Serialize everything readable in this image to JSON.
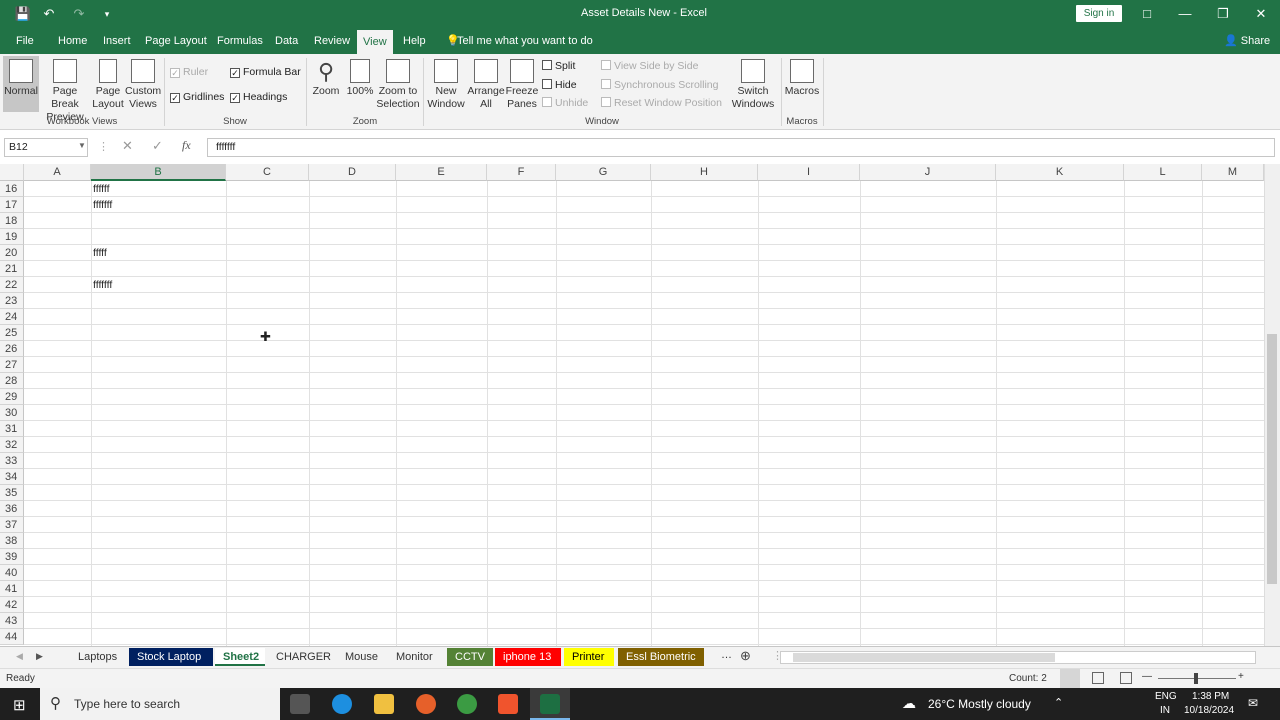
{
  "window": {
    "title": "Asset Details New  -  Excel",
    "signin": "Sign in",
    "share": "Share"
  },
  "menu": [
    "File",
    "Home",
    "Insert",
    "Page Layout",
    "Formulas",
    "Data",
    "Review",
    "View",
    "Help"
  ],
  "tell_me": "Tell me what you want to do",
  "ribbon": {
    "workbook_views": {
      "label": "Workbook Views",
      "normal": "Normal",
      "page_break_1": "Page Break",
      "page_break_2": "Preview",
      "page_layout_1": "Page",
      "page_layout_2": "Layout",
      "custom_1": "Custom",
      "custom_2": "Views"
    },
    "show": {
      "label": "Show",
      "ruler": "Ruler",
      "formula_bar": "Formula Bar",
      "gridlines": "Gridlines",
      "headings": "Headings"
    },
    "zoom": {
      "label": "Zoom",
      "zoom": "Zoom",
      "hundred": "100%",
      "zoom_sel_1": "Zoom to",
      "zoom_sel_2": "Selection"
    },
    "window": {
      "label": "Window",
      "new_1": "New",
      "new_2": "Window",
      "arrange_1": "Arrange",
      "arrange_2": "All",
      "freeze_1": "Freeze",
      "freeze_2": "Panes",
      "split": "Split",
      "hide": "Hide",
      "unhide": "Unhide",
      "side_by_side": "View Side by Side",
      "sync_scroll": "Synchronous Scrolling",
      "reset_pos": "Reset Window Position",
      "switch_1": "Switch",
      "switch_2": "Windows"
    },
    "macros": {
      "label": "Macros",
      "macros": "Macros"
    }
  },
  "formula_bar": {
    "name_box": "B12",
    "value": "fffffff"
  },
  "columns": [
    "A",
    "B",
    "C",
    "D",
    "E",
    "F",
    "G",
    "H",
    "I",
    "J",
    "K",
    "L",
    "M"
  ],
  "rows": [
    "16",
    "17",
    "18",
    "19",
    "20",
    "21",
    "22",
    "23",
    "24",
    "25",
    "26",
    "27",
    "28",
    "29",
    "30",
    "31",
    "32",
    "33",
    "34",
    "35",
    "36",
    "37",
    "38",
    "39",
    "40",
    "41",
    "42",
    "43",
    "44"
  ],
  "cells": {
    "b16": "ffffff",
    "b17": "fffffff",
    "b20": "fffff",
    "b22": "fffffff"
  },
  "sheets": [
    {
      "name": "Laptops",
      "color": ""
    },
    {
      "name": "Stock Laptop",
      "color": "#002060"
    },
    {
      "name": "Sheet2",
      "color": ""
    },
    {
      "name": "CHARGER",
      "color": ""
    },
    {
      "name": "Mouse",
      "color": ""
    },
    {
      "name": "Monitor",
      "color": ""
    },
    {
      "name": "CCTV",
      "color": "#548235"
    },
    {
      "name": "iphone 13",
      "color": "#ff0000"
    },
    {
      "name": "Printer",
      "color": "#ffff00"
    },
    {
      "name": "Essl Biometric",
      "color": "#806000"
    }
  ],
  "status": {
    "ready": "Ready",
    "count": "Count: 2"
  },
  "taskbar": {
    "search_placeholder": "Type here to search",
    "weather": "26°C  Mostly cloudy",
    "lang_1": "ENG",
    "lang_2": "IN",
    "time": "1:38 PM",
    "date": "10/18/2024"
  }
}
